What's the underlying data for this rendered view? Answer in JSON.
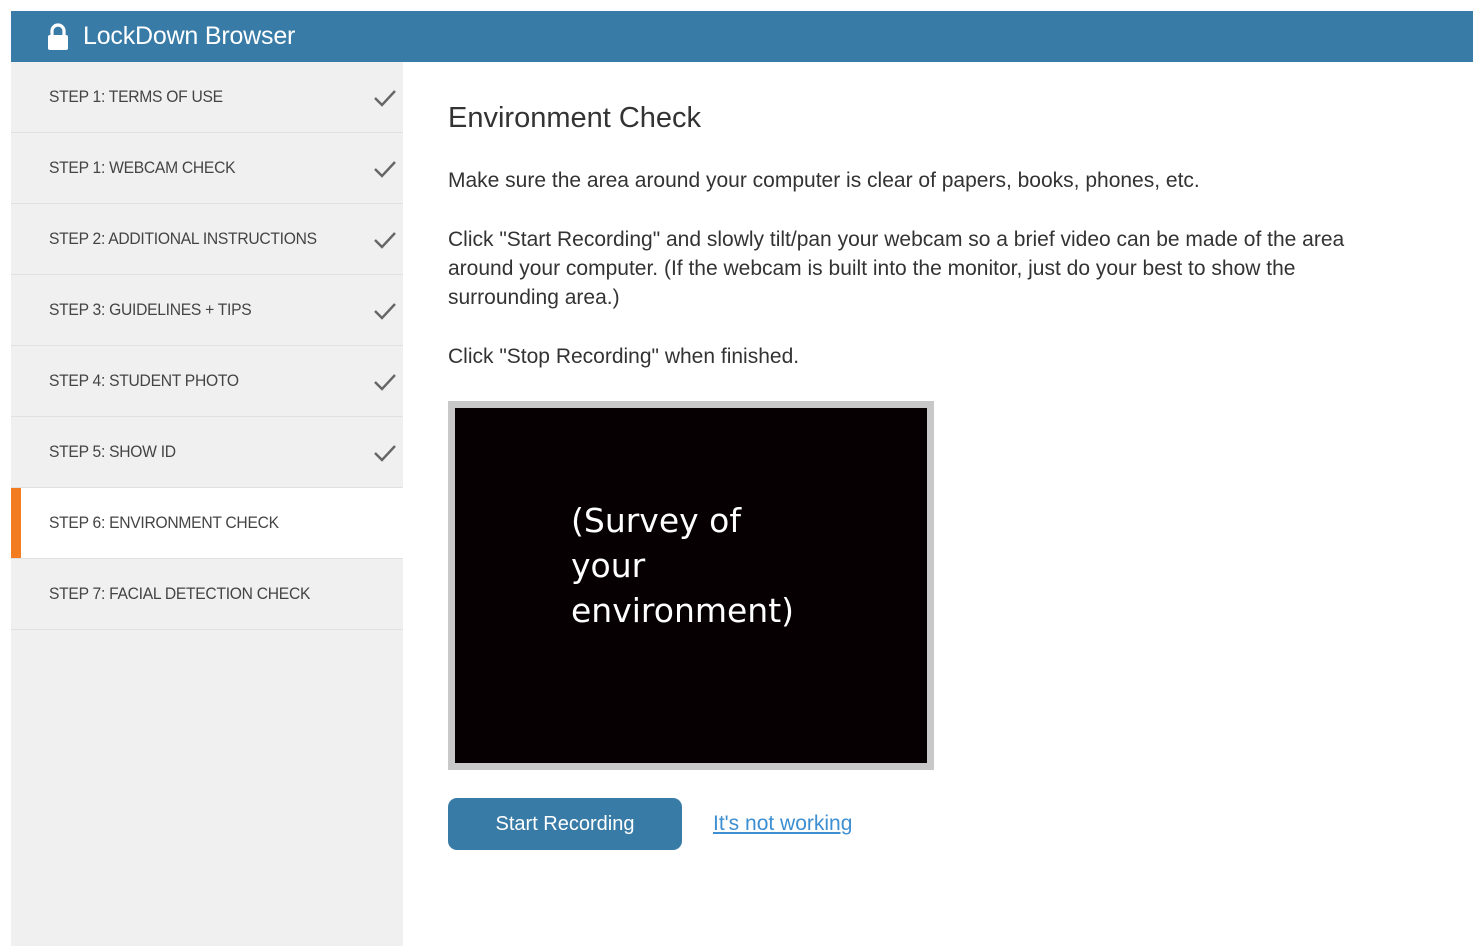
{
  "app": {
    "title": "LockDown Browser",
    "accent_color": "#387ba7",
    "active_indicator_color": "#f47c20"
  },
  "sidebar": {
    "steps": [
      {
        "label": "STEP 1: TERMS OF USE",
        "completed": true,
        "active": false
      },
      {
        "label": "STEP 1: WEBCAM CHECK",
        "completed": true,
        "active": false
      },
      {
        "label": "STEP 2: ADDITIONAL INSTRUCTIONS",
        "completed": true,
        "active": false
      },
      {
        "label": "STEP 3: GUIDELINES + TIPS",
        "completed": true,
        "active": false
      },
      {
        "label": "STEP 4: STUDENT PHOTO",
        "completed": true,
        "active": false
      },
      {
        "label": "STEP 5: SHOW ID",
        "completed": true,
        "active": false
      },
      {
        "label": "STEP 6: ENVIRONMENT CHECK",
        "completed": false,
        "active": true
      },
      {
        "label": "STEP 7: FACIAL DETECTION CHECK",
        "completed": false,
        "active": false
      }
    ]
  },
  "main": {
    "heading": "Environment Check",
    "paragraphs": [
      "Make sure the area around your computer is clear of papers, books, phones, etc.",
      "Click \"Start Recording\" and slowly tilt/pan your webcam so a brief video can be made of the area around your computer. (If the webcam is built into the monitor, just do your best to show the surrounding area.)",
      "Click \"Stop Recording\" when finished."
    ],
    "video_caption": "(Survey of your environment)",
    "start_button_label": "Start Recording",
    "help_link_label": "It's not working"
  }
}
